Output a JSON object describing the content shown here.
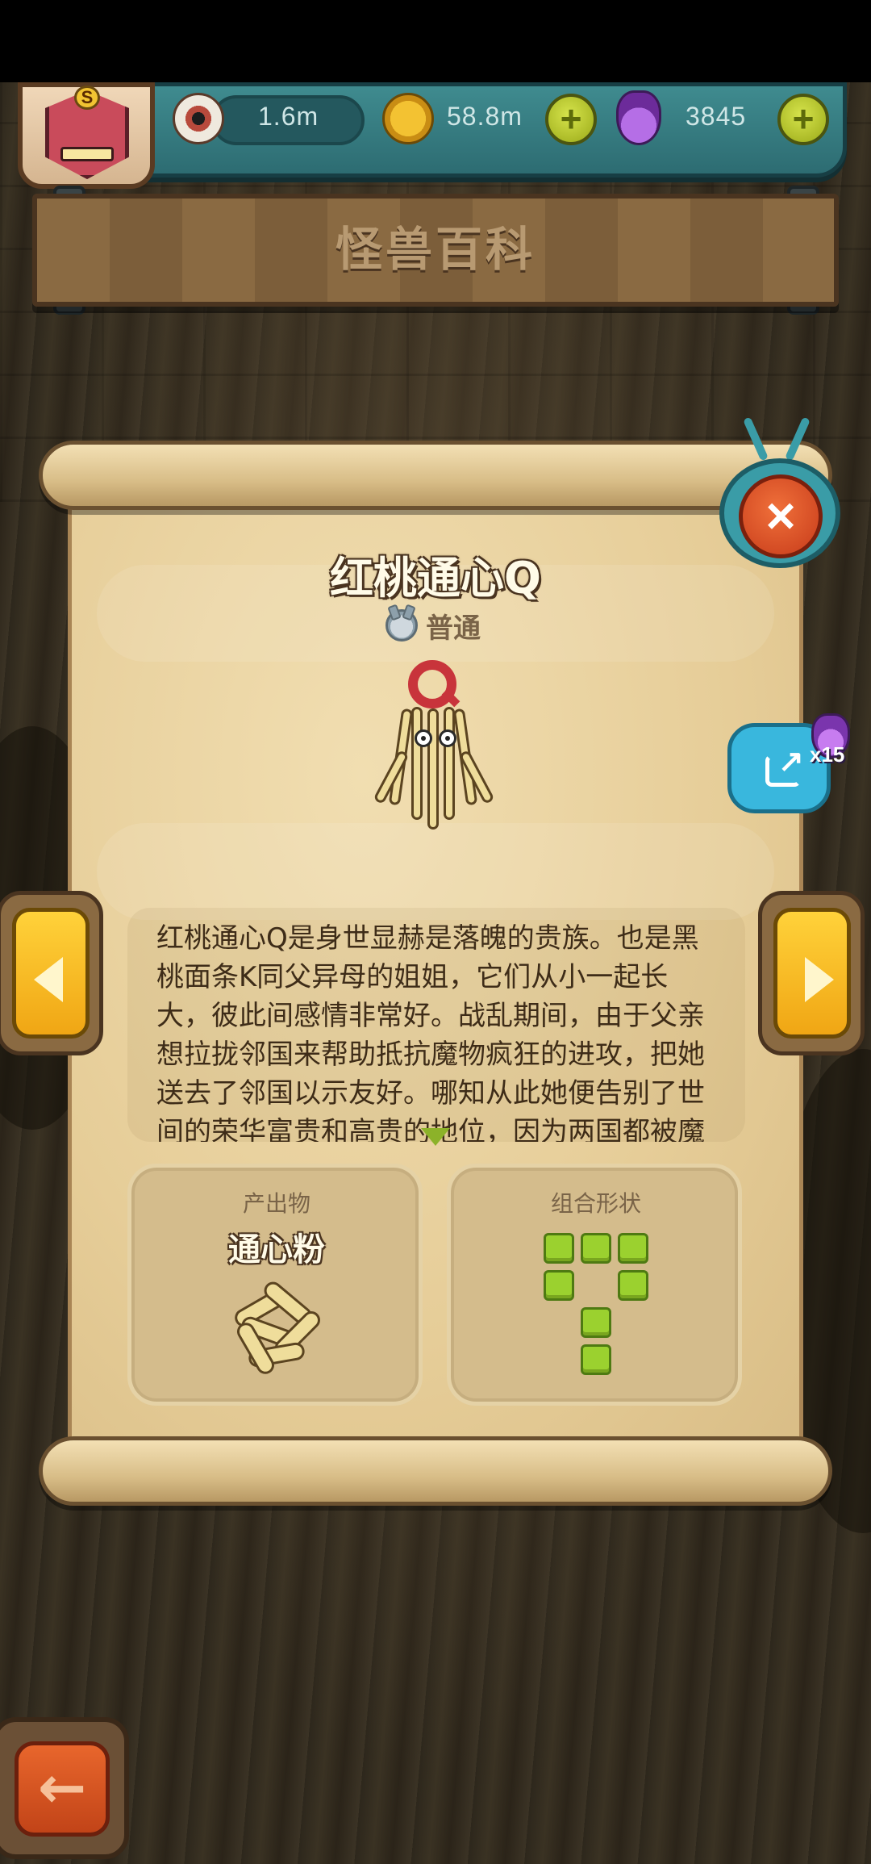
{
  "header": {
    "resources": [
      {
        "icon": "eyeball-icon",
        "value": "1.6m"
      },
      {
        "icon": "coin-icon",
        "value": "58.8m"
      },
      {
        "icon": "potion-icon",
        "value": "3845"
      }
    ],
    "plus_label": "+",
    "avatar_badge": "S"
  },
  "title": "怪兽百科",
  "monster": {
    "name": "红桃通心Q",
    "rarity": "普通",
    "description": "红桃通心Q是身世显赫是落魄的贵族。也是黑桃面条K同父异母的姐姐，它们从小一起长大，彼此间感情非常好。战乱期间，由于父亲想拉拢邻国来帮助抵抗魔物疯狂的进攻，把她送去了邻国以示友好。哪知从此她便告别了世间的荣华富贵和高贵的地位，因为两国都被魔"
  },
  "product": {
    "title": "产出物",
    "name": "通心粉"
  },
  "shape": {
    "title": "组合形状",
    "cells": [
      [
        0,
        0
      ],
      [
        1,
        0
      ],
      [
        2,
        0
      ],
      [
        0,
        1
      ],
      [
        2,
        1
      ],
      [
        1,
        2
      ],
      [
        1,
        3
      ]
    ]
  },
  "share": {
    "reward_count": "x15"
  },
  "buttons": {
    "close": "×",
    "back": "←"
  },
  "colors": {
    "accent_teal": "#3f8b8f",
    "close_red": "#d94a24",
    "arrow_yellow": "#ffd23a",
    "shape_green": "#9bd12f"
  }
}
